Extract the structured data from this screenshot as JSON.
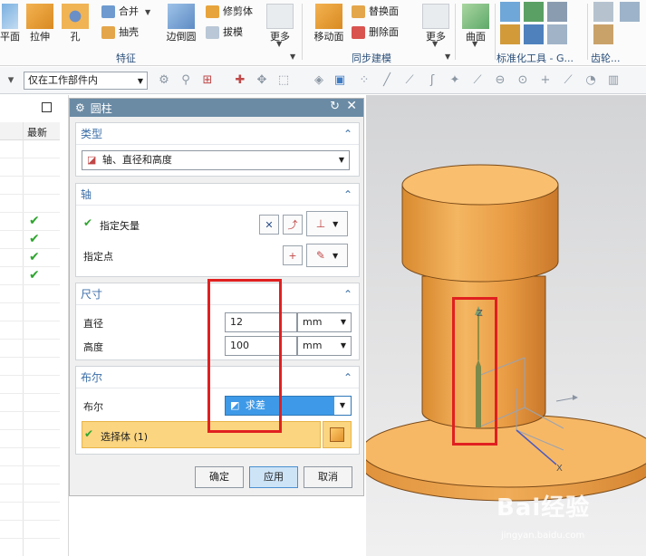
{
  "ribbon": {
    "big_buttons": [
      "平面",
      "拉伸",
      "孔",
      "边倒圆",
      "更多",
      "移动面",
      "更多",
      "曲面"
    ],
    "small_buttons": [
      "合并",
      "抽壳",
      "修剪体",
      "拔模",
      "替换面",
      "删除面"
    ],
    "group_labels": [
      "特征",
      "同步建模",
      "标准化工具 - G...",
      "齿轮..."
    ]
  },
  "toolbar": {
    "selection_filter": "仅在工作部件内"
  },
  "left_panel": {
    "header_label": "最新",
    "checked_rows": 4
  },
  "dialog": {
    "title": "圆柱",
    "type_section": {
      "header": "类型",
      "value": "轴、直径和高度"
    },
    "axis_section": {
      "header": "轴",
      "vector_label": "指定矢量",
      "point_label": "指定点"
    },
    "size_section": {
      "header": "尺寸",
      "diameter_label": "直径",
      "diameter_value": "12",
      "diameter_unit": "mm",
      "height_label": "高度",
      "height_value": "100",
      "height_unit": "mm"
    },
    "boolean_section": {
      "header": "布尔",
      "boolean_label": "布尔",
      "boolean_value": "求差",
      "select_body": "选择体 (1)"
    },
    "buttons": {
      "ok": "确定",
      "apply": "应用",
      "cancel": "取消"
    }
  },
  "viewport": {
    "axis_z": "Z",
    "axis_x": "X",
    "part_color": "#f5a84a"
  },
  "watermark": {
    "brand": "Bai经验",
    "url": "jingyan.baidu.com"
  }
}
